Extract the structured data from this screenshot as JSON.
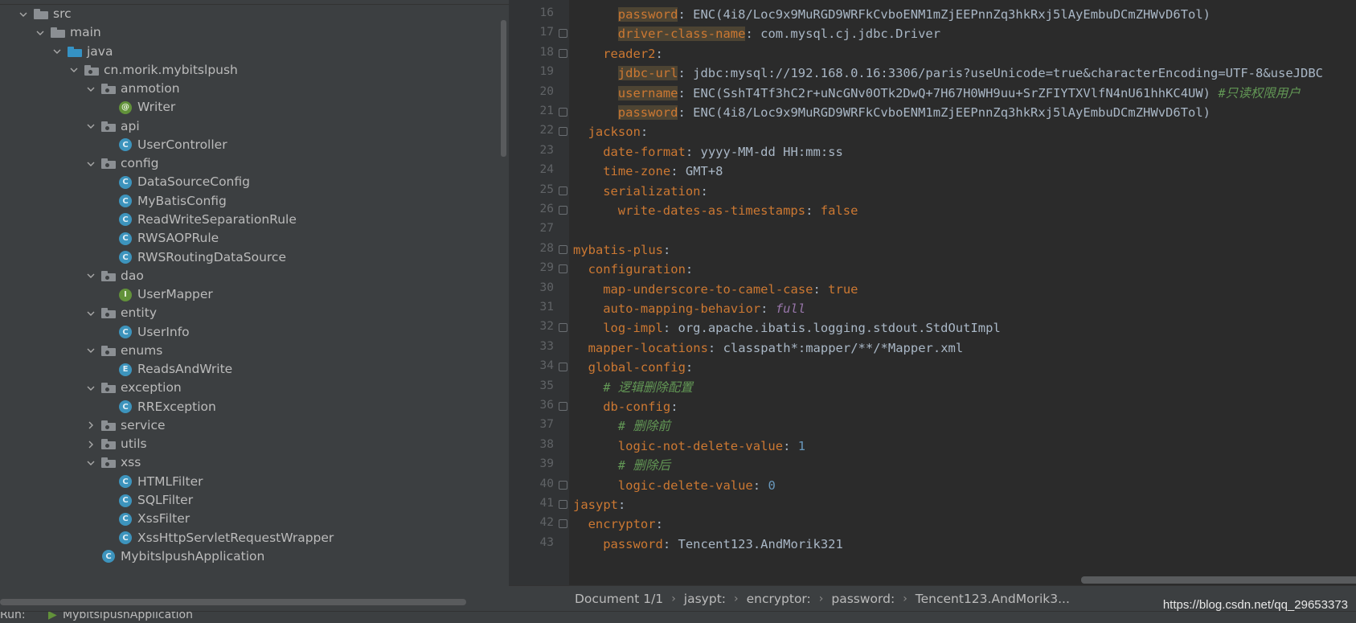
{
  "project_tree": [
    {
      "label": "src",
      "icon": "folder-icon",
      "expanded": true
    },
    {
      "label": "main",
      "icon": "folder-icon",
      "expanded": true
    },
    {
      "label": "java",
      "icon": "source-folder-icon",
      "expanded": true
    },
    {
      "label": "cn.morik.mybitslpush",
      "icon": "package-icon",
      "expanded": true
    },
    {
      "label": "anmotion",
      "icon": "package-icon",
      "expanded": true
    },
    {
      "label": "Writer",
      "icon": "annotation-icon"
    },
    {
      "label": "api",
      "icon": "package-icon",
      "expanded": true
    },
    {
      "label": "UserController",
      "icon": "class-icon"
    },
    {
      "label": "config",
      "icon": "package-icon",
      "expanded": true
    },
    {
      "label": "DataSourceConfig",
      "icon": "class-icon"
    },
    {
      "label": "MyBatisConfig",
      "icon": "class-icon"
    },
    {
      "label": "ReadWriteSeparationRule",
      "icon": "class-icon"
    },
    {
      "label": "RWSAOPRule",
      "icon": "class-icon"
    },
    {
      "label": "RWSRoutingDataSource",
      "icon": "class-icon"
    },
    {
      "label": "dao",
      "icon": "package-icon",
      "expanded": true
    },
    {
      "label": "UserMapper",
      "icon": "interface-icon"
    },
    {
      "label": "entity",
      "icon": "package-icon",
      "expanded": true
    },
    {
      "label": "UserInfo",
      "icon": "class-icon"
    },
    {
      "label": "enums",
      "icon": "package-icon",
      "expanded": true
    },
    {
      "label": "ReadsAndWrite",
      "icon": "enum-icon"
    },
    {
      "label": "exception",
      "icon": "package-icon",
      "expanded": true
    },
    {
      "label": "RRException",
      "icon": "exception-class-icon"
    },
    {
      "label": "service",
      "icon": "package-icon",
      "expanded": false
    },
    {
      "label": "utils",
      "icon": "package-icon",
      "expanded": false
    },
    {
      "label": "xss",
      "icon": "package-icon",
      "expanded": true
    },
    {
      "label": "HTMLFilter",
      "icon": "class-icon"
    },
    {
      "label": "SQLFilter",
      "icon": "class-icon"
    },
    {
      "label": "XssFilter",
      "icon": "class-icon"
    },
    {
      "label": "XssHttpServletRequestWrapper",
      "icon": "class-icon"
    },
    {
      "label": "MybitslpushApplication",
      "icon": "spring-boot-class-icon"
    }
  ],
  "editor": {
    "line_numbers": [
      "16",
      "17",
      "18",
      "19",
      "20",
      "21",
      "22",
      "23",
      "24",
      "25",
      "26",
      "27",
      "28",
      "29",
      "30",
      "31",
      "32",
      "33",
      "34",
      "35",
      "36",
      "37",
      "38",
      "39",
      "40",
      "41",
      "42",
      "43"
    ],
    "lines": [
      {
        "key": "password",
        "sep": ": ",
        "value": "ENC(4i8/Loc9x9MuRGD9WRFkCvboENM1mZjEEPnnZq3hkRxj5lAyEmbuDCmZHWvD6Tol)"
      },
      {
        "key": "driver-class-name",
        "sep": ": ",
        "value": "com.mysql.cj.jdbc.Driver"
      },
      {
        "key": "reader2",
        "sep": ":",
        "value": ""
      },
      {
        "key": "jdbc-url",
        "sep": ": ",
        "value": "jdbc:mysql://192.168.0.16:3306/paris?useUnicode=true&characterEncoding=UTF-8&useJDBC"
      },
      {
        "key": "username",
        "sep": ": ",
        "value": "ENC(SshT4Tf3hC2r+uNcGNv0OTk2DwQ+7H67H0WH9uu+SrZFIYTXVlfN4nU61hhKC4UW)",
        "comment": "#只读权限用户"
      },
      {
        "key": "password",
        "sep": ": ",
        "value": "ENC(4i8/Loc9x9MuRGD9WRFkCvboENM1mZjEEPnnZq3hkRxj5lAyEmbuDCmZHWvD6Tol)"
      },
      {
        "key": "jackson",
        "sep": ":",
        "value": ""
      },
      {
        "key": "date-format",
        "sep": ": ",
        "value": "yyyy-MM-dd HH:mm:ss"
      },
      {
        "key": "time-zone",
        "sep": ": ",
        "value": "GMT+8"
      },
      {
        "key": "serialization",
        "sep": ":",
        "value": ""
      },
      {
        "key": "write-dates-as-timestamps",
        "sep": ": ",
        "value": "false"
      },
      {
        "key": "",
        "sep": "",
        "value": ""
      },
      {
        "key": "mybatis-plus",
        "sep": ":",
        "value": ""
      },
      {
        "key": "configuration",
        "sep": ":",
        "value": ""
      },
      {
        "key": "map-underscore-to-camel-case",
        "sep": ": ",
        "value": "true"
      },
      {
        "key": "auto-mapping-behavior",
        "sep": ": ",
        "value": "full"
      },
      {
        "key": "log-impl",
        "sep": ": ",
        "value": "org.apache.ibatis.logging.stdout.StdOutImpl"
      },
      {
        "key": "mapper-locations",
        "sep": ": ",
        "value": "classpath*:mapper/**/*Mapper.xml"
      },
      {
        "key": "global-config",
        "sep": ":",
        "value": ""
      },
      {
        "key": "",
        "sep": "",
        "value": "",
        "comment": "# 逻辑删除配置"
      },
      {
        "key": "db-config",
        "sep": ":",
        "value": ""
      },
      {
        "key": "",
        "sep": "",
        "value": "",
        "comment": "# 删除前"
      },
      {
        "key": "logic-not-delete-value",
        "sep": ": ",
        "value": "1"
      },
      {
        "key": "",
        "sep": "",
        "value": "",
        "comment": "# 删除后"
      },
      {
        "key": "logic-delete-value",
        "sep": ": ",
        "value": "0"
      },
      {
        "key": "jasypt",
        "sep": ":",
        "value": ""
      },
      {
        "key": "encryptor",
        "sep": ":",
        "value": ""
      },
      {
        "key": "password",
        "sep": ": ",
        "value": "Tencent123.AndMorik321"
      }
    ]
  },
  "breadcrumb": [
    "Document 1/1",
    "jasypt:",
    "encryptor:",
    "password:",
    "Tencent123.AndMorik3..."
  ],
  "watermark": "https://blog.csdn.net/qq_29653373",
  "run_bar": {
    "label": "Run:",
    "config": "MybitslpushApplication"
  }
}
